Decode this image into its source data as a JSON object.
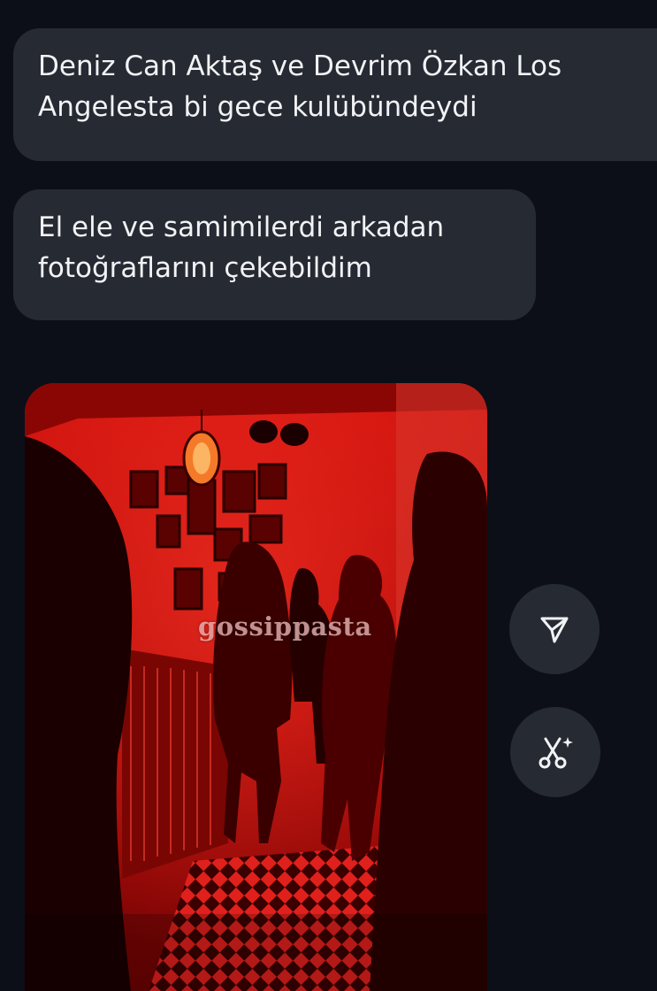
{
  "messages": [
    {
      "lines": [
        "Deniz Can Aktaş ve Devrim Özkan Los",
        "Angelesta bi gece kulübündeydi"
      ]
    },
    {
      "lines": [
        "El ele ve samimilerdi arkadan",
        "fotoğraflarını çekebildim"
      ]
    }
  ],
  "photo": {
    "watermark": "gossippasta",
    "subject": "red-lit nightclub interior photo"
  },
  "actions": {
    "share_icon": "send-icon",
    "cut_icon": "scissors-sparkle-icon"
  },
  "colors": {
    "background": "#0c0f17",
    "bubble": "#262a33",
    "text": "#f2f3f5",
    "photo_red": "#c40a0a"
  }
}
